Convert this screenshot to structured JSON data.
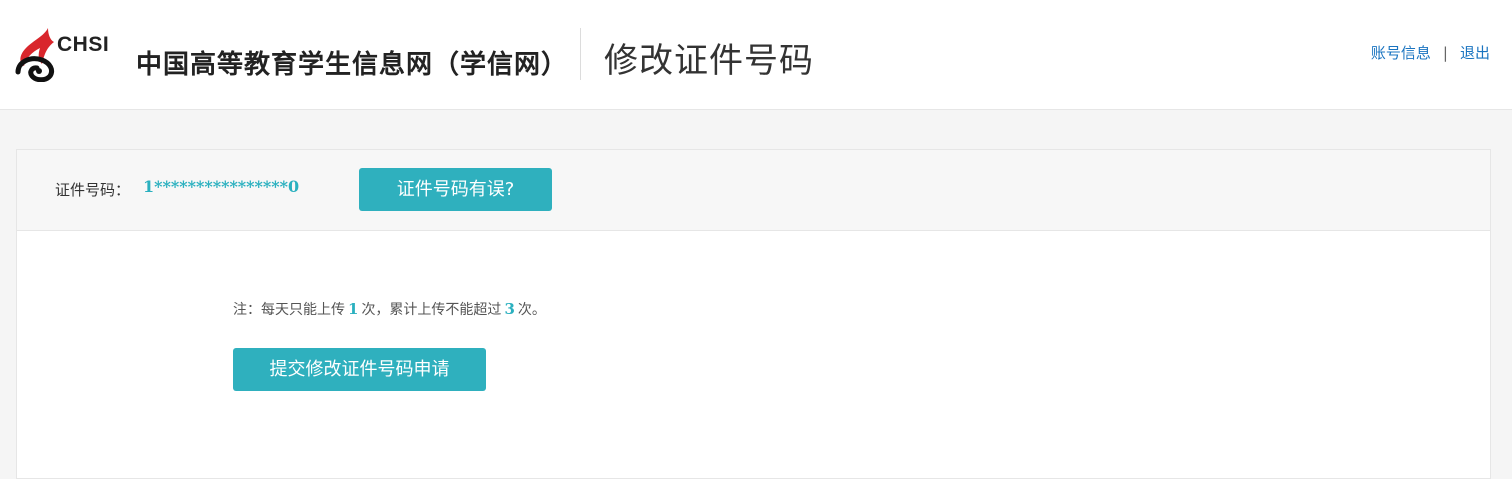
{
  "header": {
    "logo_text": "CHSI",
    "site_name": "中国高等教育学生信息网（学信网）",
    "page_title": "修改证件号码",
    "links": {
      "account": "账号信息",
      "separator": "|",
      "logout": "退出"
    }
  },
  "id_bar": {
    "label": "证件号码：",
    "value": "1****************0",
    "error_button": "证件号码有误?"
  },
  "note": {
    "prefix": "注：每天只能上传",
    "daily_limit": "1",
    "middle": "次，累计上传不能超过",
    "total_limit": "3",
    "suffix": "次。"
  },
  "submit_button": "提交修改证件号码申请",
  "colors": {
    "accent": "#2fb0be",
    "link": "#1a74c0",
    "logo_red": "#d9262c"
  }
}
